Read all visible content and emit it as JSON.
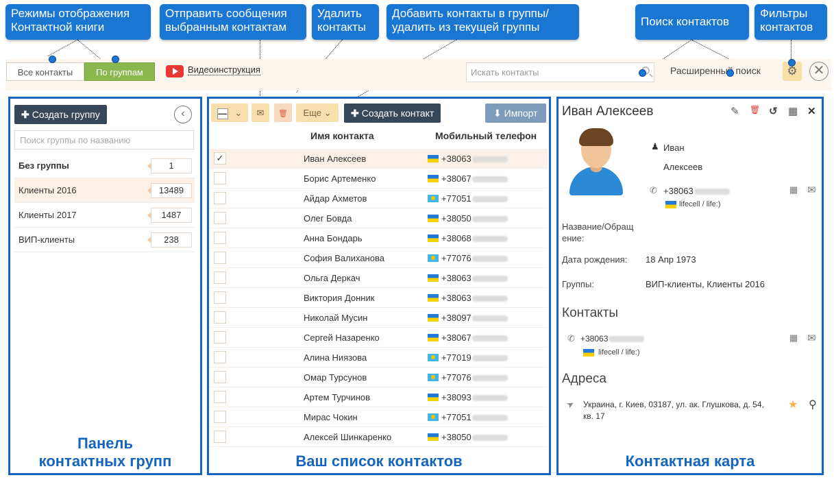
{
  "callouts": {
    "modes": "Режимы отображения\nКонтактной книги",
    "send": "Отправить сообщения\nвыбранным контактам",
    "delete": "Удалить\nконтакты",
    "groups": "Добавить контакты в группы/\nудалить из текущей группы",
    "search": "Поиск контактов",
    "filters": "Фильтры\nконтактов"
  },
  "topbar": {
    "mode_all": "Все контакты",
    "mode_groups": "По группам",
    "video_link": "Видеоинструкция",
    "search_placeholder": "Искать контакты",
    "advanced_search": "Расширенный поиск",
    "gear_icon": "⚙",
    "close_icon": "✕"
  },
  "groups_panel": {
    "create_button": "Создать группу",
    "search_placeholder": "Поиск группы по названию",
    "back_icon": "‹",
    "items": [
      {
        "name": "Без группы",
        "count": "1"
      },
      {
        "name": "Клиенты 2016",
        "count": "13489"
      },
      {
        "name": "Клиенты 2017",
        "count": "1487"
      },
      {
        "name": "ВИП-клиенты",
        "count": "238"
      }
    ],
    "caption": "Панель\nконтактных групп"
  },
  "contacts_panel": {
    "toolbar": {
      "select_glyph": "—",
      "chevron": "⌄",
      "mail_glyph": "✉",
      "trash_glyph": "🗑",
      "more_label": "Еще",
      "create_contact": "Создать контакт",
      "import": "Импорт"
    },
    "columns": {
      "name": "Имя контакта",
      "phone": "Мобильный телефон"
    },
    "rows": [
      {
        "name": "Иван Алексеев",
        "phone": "+38063",
        "flag": "ua",
        "checked": "✓"
      },
      {
        "name": "Борис Артеменко",
        "phone": "+38067",
        "flag": "ua",
        "checked": ""
      },
      {
        "name": "Айдар Ахметов",
        "phone": "+77051",
        "flag": "kz",
        "checked": ""
      },
      {
        "name": "Олег Бовда",
        "phone": "+38050",
        "flag": "ua",
        "checked": ""
      },
      {
        "name": "Анна Бондарь",
        "phone": "+38068",
        "flag": "ua",
        "checked": ""
      },
      {
        "name": "София Валиханова",
        "phone": "+77076",
        "flag": "kz",
        "checked": ""
      },
      {
        "name": "Ольга Деркач",
        "phone": "+38063",
        "flag": "ua",
        "checked": ""
      },
      {
        "name": "Виктория Донник",
        "phone": "+38063",
        "flag": "ua",
        "checked": ""
      },
      {
        "name": "Николай Мусин",
        "phone": "+38097",
        "flag": "ua",
        "checked": ""
      },
      {
        "name": "Сергей Назаренко",
        "phone": "+38067",
        "flag": "ua",
        "checked": ""
      },
      {
        "name": "Алина Ниязова",
        "phone": "+77019",
        "flag": "kz",
        "checked": ""
      },
      {
        "name": "Омар Турсунов",
        "phone": "+77076",
        "flag": "kz",
        "checked": ""
      },
      {
        "name": "Артем Турчинов",
        "phone": "+38093",
        "flag": "ua",
        "checked": ""
      },
      {
        "name": "Мирас Чокин",
        "phone": "+77051",
        "flag": "kz",
        "checked": ""
      },
      {
        "name": "Алексей Шинкаренко",
        "phone": "+38050",
        "flag": "ua",
        "checked": ""
      }
    ],
    "caption": "Ваш список контактов"
  },
  "card": {
    "name": "Иван Алексеев",
    "first_name": "Иван",
    "last_name": "Алексеев",
    "phone": "+38063",
    "operator": "lifecell / life:)",
    "label_title": "Название/Обращ\nение:",
    "label_birthday": "Дата рождения:",
    "birthday": "18 Апр 1973",
    "label_groups": "Группы:",
    "groups": "ВИП-клиенты, Клиенты 2016",
    "contacts_title": "Контакты",
    "contacts_phone": "+38063",
    "contacts_operator": "lifecell / life:)",
    "addresses_title": "Адреса",
    "address": "Украина, г. Киев, 03187, ул. ак. Глушкова, д. 54,\nкв. 17",
    "icons": {
      "edit": "✎",
      "delete": "🗑",
      "history": "↺",
      "qr": "▦",
      "close": "✕",
      "mail": "✉",
      "phone": "✆",
      "person": "♟",
      "nav": "➤",
      "star": "★",
      "pin": "⚲"
    },
    "caption": "Контактная карта"
  }
}
